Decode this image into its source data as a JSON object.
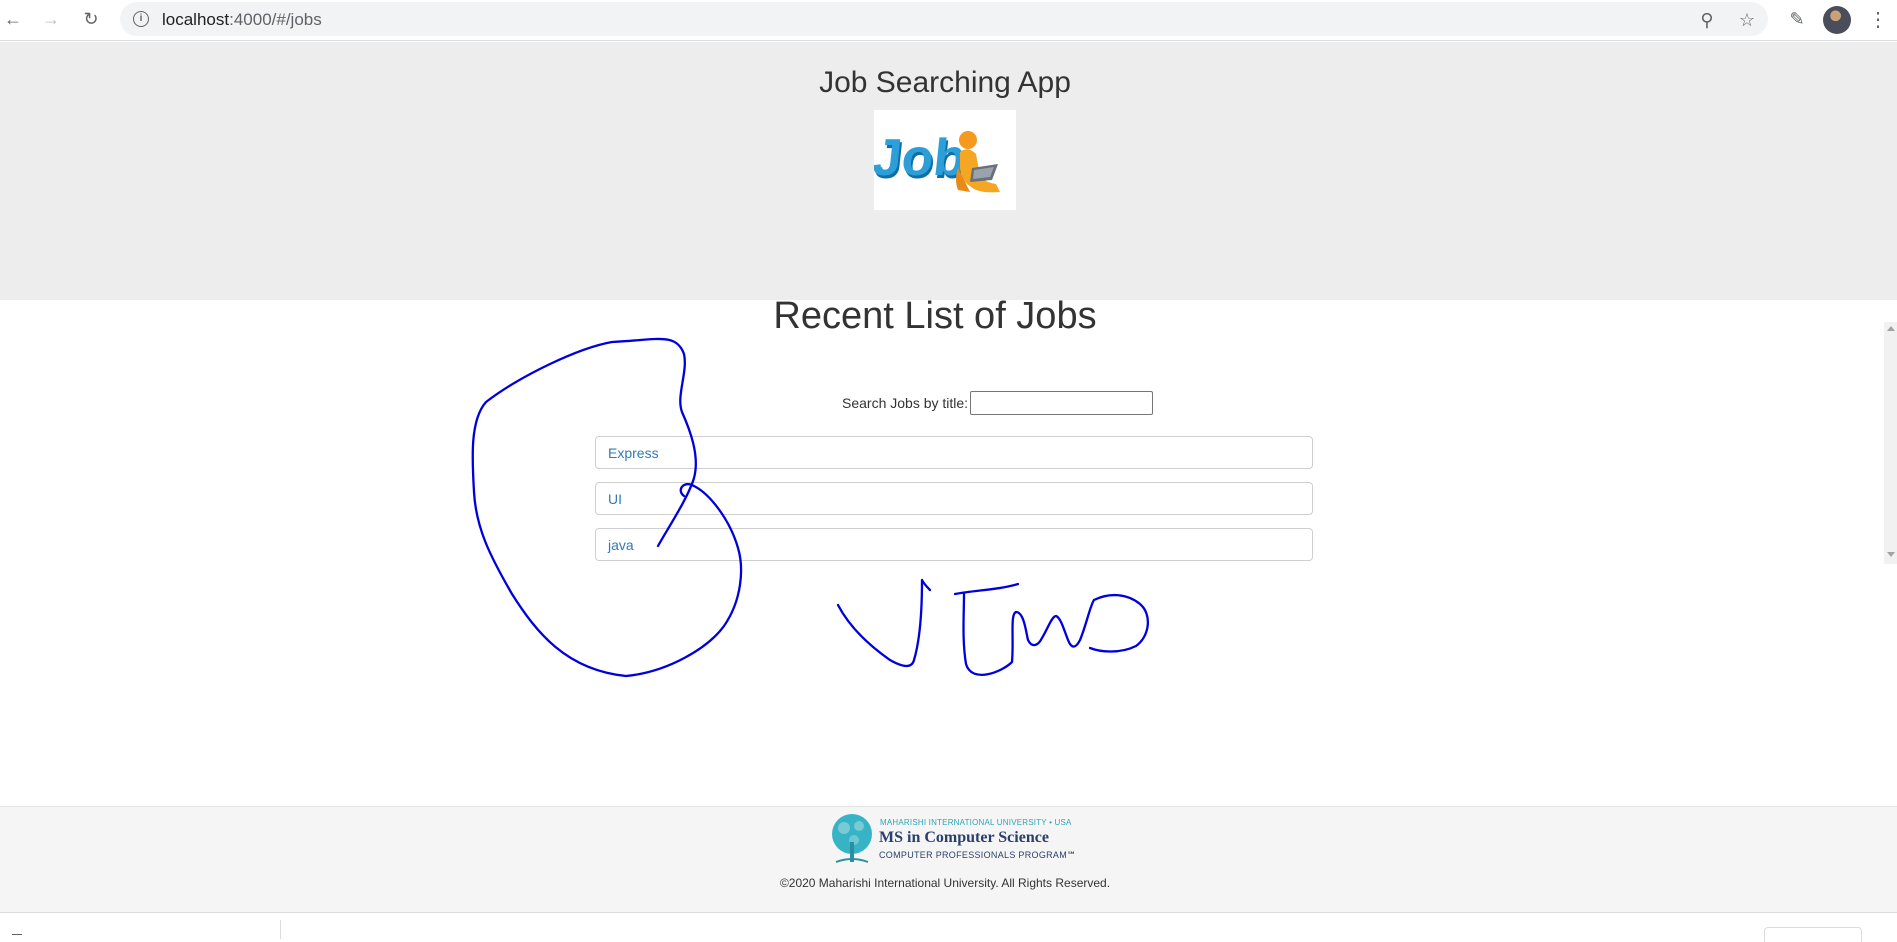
{
  "browser": {
    "url_host": "localhost",
    "url_path": ":4000/#/jobs",
    "icons": [
      "back-icon",
      "forward-icon",
      "reload-icon",
      "info-icon",
      "zoom-icon",
      "star-icon",
      "extensions-icon",
      "more-icon"
    ]
  },
  "header": {
    "title": "Job Searching App",
    "logo_text": "Job"
  },
  "main": {
    "title": "Recent List of Jobs",
    "search_label": "Search Jobs by title:",
    "search_value": "",
    "jobs": [
      {
        "title": "Express"
      },
      {
        "title": "UI"
      },
      {
        "title": "java"
      }
    ]
  },
  "footer": {
    "university_line": "MAHARISHI INTERNATIONAL UNIVERSITY • USA",
    "program_title": "MS in Computer Science",
    "program_sub": "COMPUTER PROFESSIONALS PROGRAM℠",
    "copyright": "©2020 Maharishi International University. All Rights Reserved."
  },
  "colors": {
    "link": "#337ab7",
    "header_bg": "#ededed",
    "ink": "#0000dd",
    "footer_teal": "#2aa6b8",
    "footer_navy": "#2a3f6b"
  }
}
